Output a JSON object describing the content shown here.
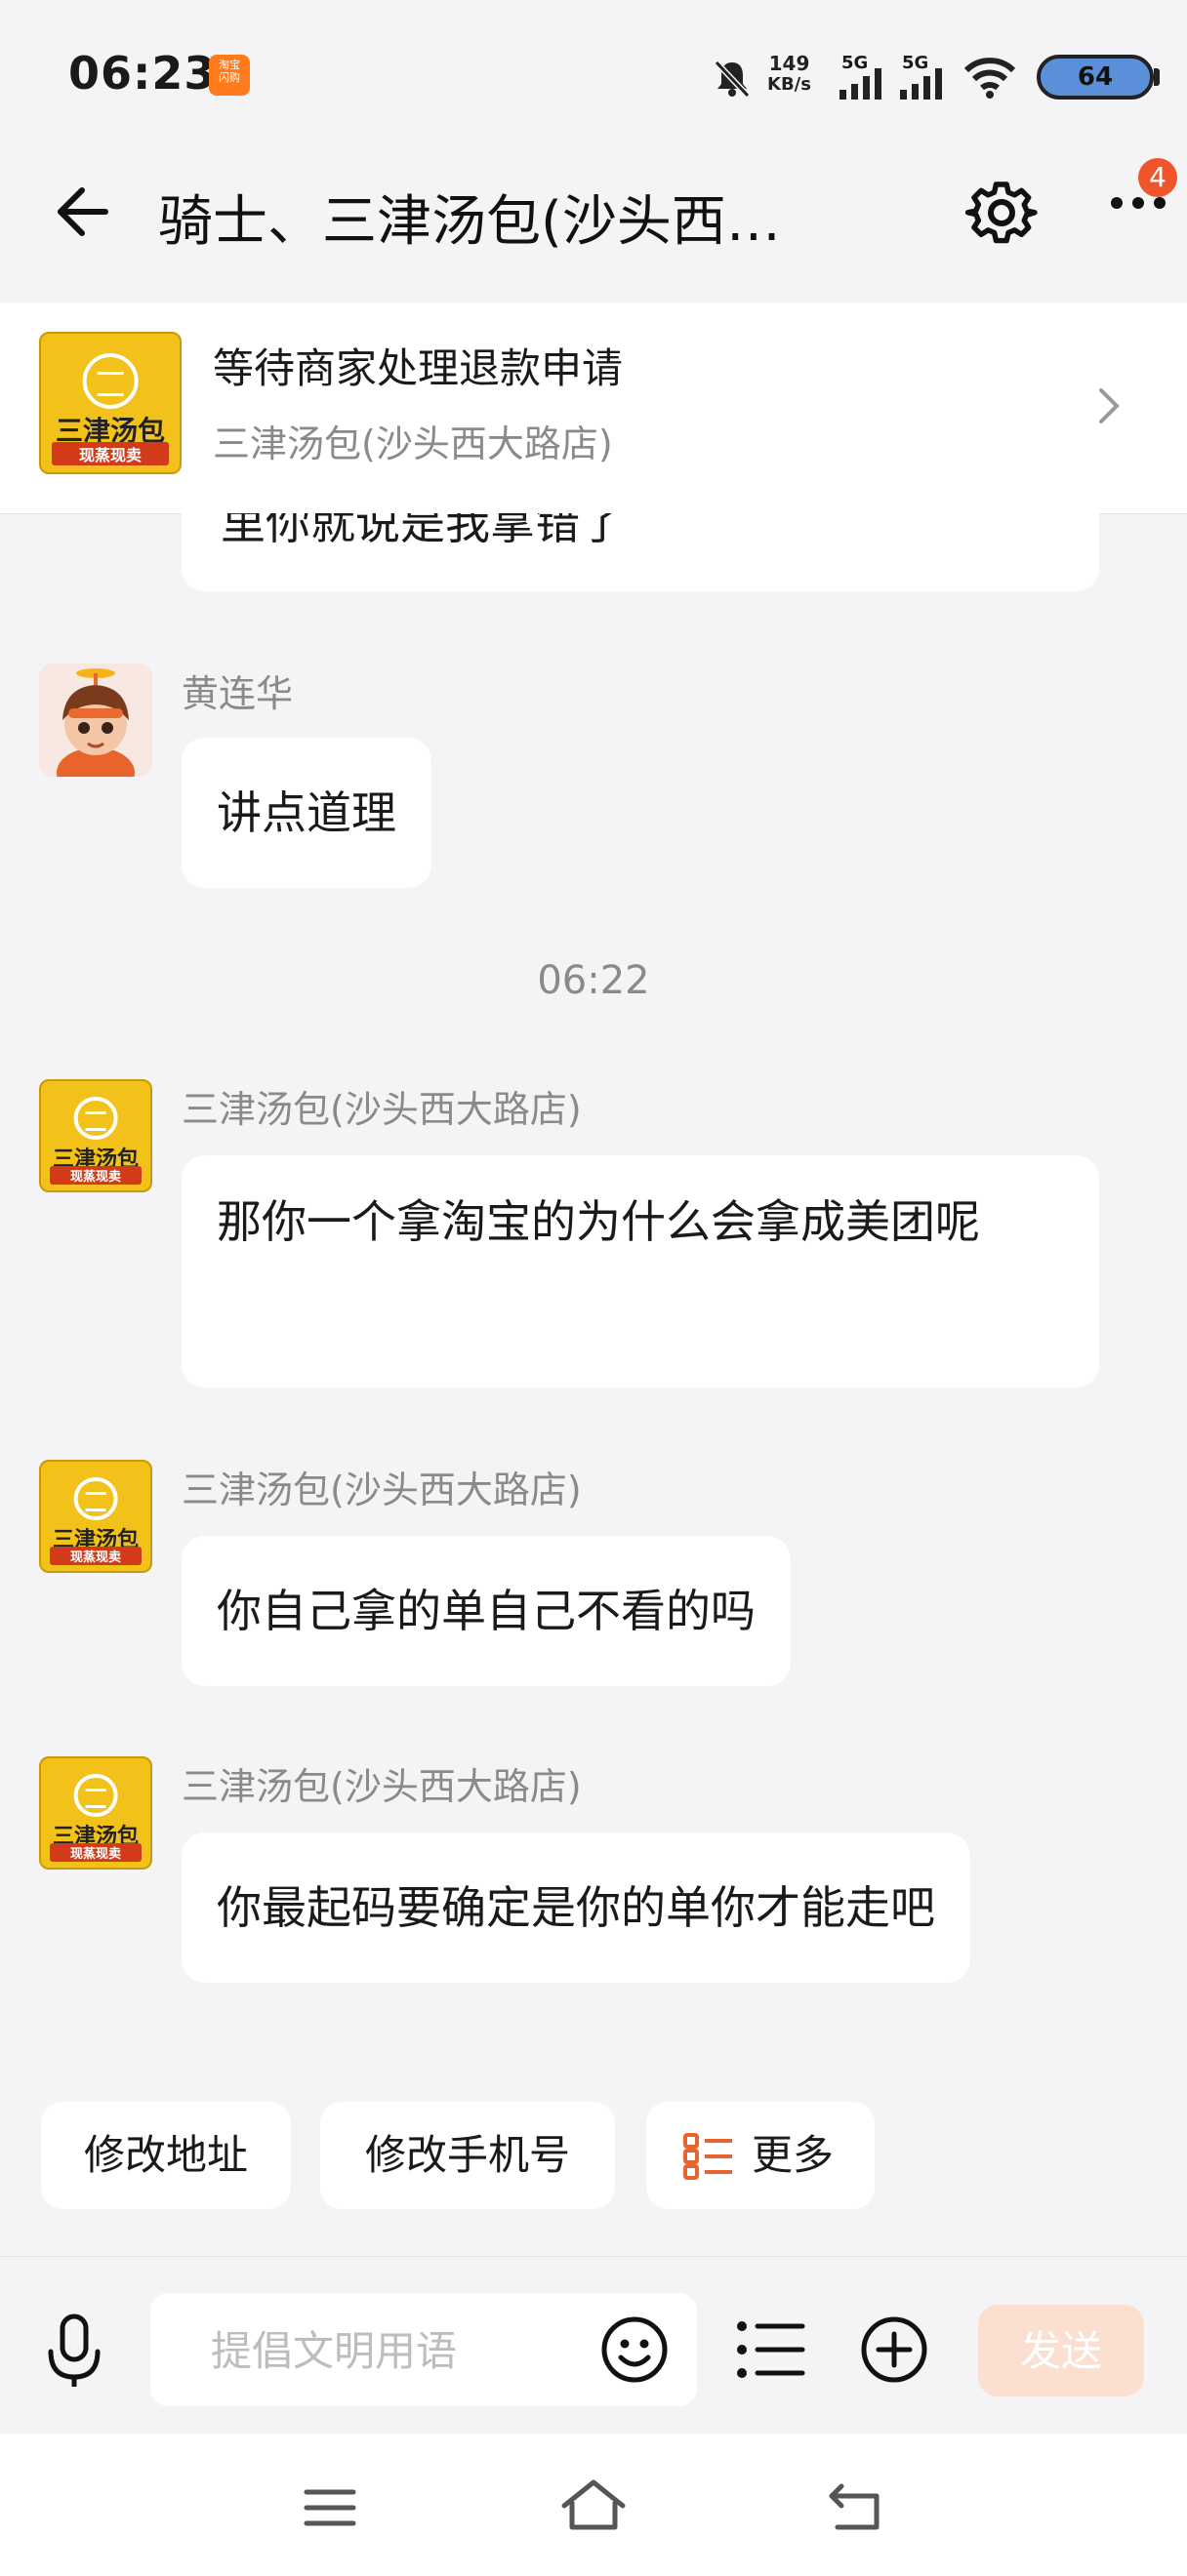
{
  "status_bar": {
    "time": "06:23",
    "mini_app": "淘宝\n闪购",
    "net_speed_value": "149",
    "net_speed_unit": "KB/s",
    "signal1_label": "5G",
    "signal2_label": "5G",
    "battery": "64"
  },
  "header": {
    "title": "骑士、三津汤包(沙头西…",
    "badge": "4",
    "icons": [
      "back-arrow-icon",
      "gear-icon",
      "more-icon"
    ]
  },
  "order_banner": {
    "logo_line1": "三津汤包",
    "logo_line2": "现蒸现卖",
    "title": "等待商家处理退款申请",
    "subtitle": "三津汤包(沙头西大路店)"
  },
  "messages": [
    {
      "sender": "",
      "text": "里你就说是我拿错了",
      "partial": true
    },
    {
      "sender": "黄连华",
      "text": "讲点道理"
    },
    {
      "sender": "三津汤包(沙头西大路店)",
      "text": "那你一个拿淘宝的为什么会拿成美团呢"
    },
    {
      "sender": "三津汤包(沙头西大路店)",
      "text": "你自己拿的单自己不看的吗"
    },
    {
      "sender": "三津汤包(沙头西大路店)",
      "text": "你最起码要确定是你的单你才能走吧"
    }
  ],
  "timestamp": "06:22",
  "quick_actions": [
    "修改地址",
    "修改手机号",
    "更多"
  ],
  "input": {
    "placeholder": "提倡文明用语",
    "value": "",
    "send_label": "发送"
  },
  "colors": {
    "background": "#f4f4f6",
    "accent_orange": "#f0542a",
    "send_disabled": "#fbe0d1",
    "logo_yellow": "#f2c21a"
  }
}
